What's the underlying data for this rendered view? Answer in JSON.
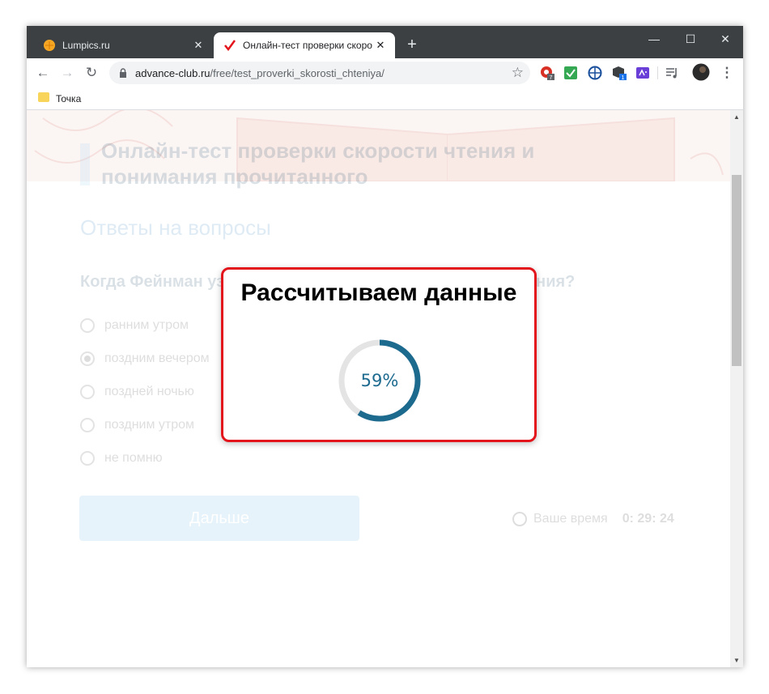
{
  "browser": {
    "tabs": [
      {
        "label": "Lumpics.ru",
        "active": false
      },
      {
        "label": "Онлайн-тест проверки скорост",
        "active": true
      }
    ],
    "new_tab": "+",
    "window_controls": {
      "minimize": "—",
      "maximize": "☐",
      "close": "✕"
    },
    "url_host": "advance-club.ru",
    "url_path": "/free/test_proverki_skorosti_chteniya/",
    "bookmarks": [
      {
        "label": "Точка"
      }
    ],
    "extension_badges": [
      "7",
      "1"
    ]
  },
  "page": {
    "title": "Онлайн-тест проверки скорости чтения и понимания прочитанного",
    "section_title": "Ответы на вопросы",
    "question": "Когда Фейнман узнал самую ценную деталь тайного знания?",
    "options": [
      {
        "label": "ранним утром",
        "selected": false
      },
      {
        "label": "поздним вечером",
        "selected": true
      },
      {
        "label": "поздней ночью",
        "selected": false
      },
      {
        "label": "поздним утром",
        "selected": false
      },
      {
        "label": "не помню",
        "selected": false
      }
    ],
    "next_button": "Дальше",
    "timer_label": "Ваше время",
    "timer_value": "0: 29: 24"
  },
  "modal": {
    "title": "Рассчитываем данные",
    "progress_percent": 59,
    "progress_text": "59%"
  },
  "colors": {
    "highlight_border": "#e3141b",
    "progress": "#1d6a8f",
    "progress_track": "#e4e4e4"
  }
}
